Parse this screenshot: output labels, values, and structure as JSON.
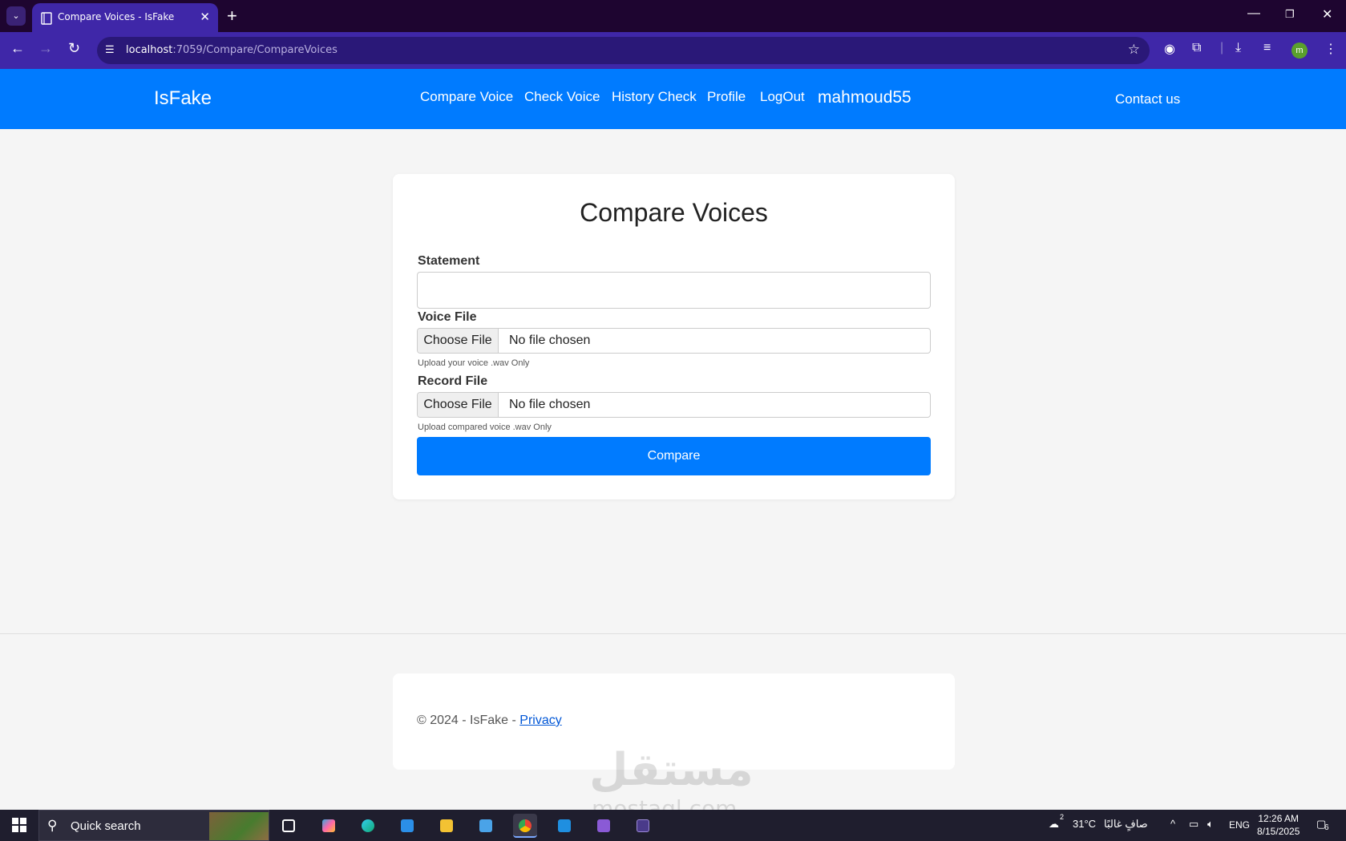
{
  "browser": {
    "tab_title": "Compare Voices - IsFake",
    "url_host": "localhost",
    "url_path": ":7059/Compare/CompareVoices",
    "profile_initial": "m"
  },
  "site": {
    "brand": "IsFake",
    "nav": [
      "Compare Voice",
      "Check Voice",
      "History Check",
      "Profile",
      "LogOut"
    ],
    "username": "mahmoud55",
    "contact": "Contact us"
  },
  "form": {
    "title": "Compare Voices",
    "statement_label": "Statement",
    "statement_value": "",
    "voice_label": "Voice File",
    "voice_button": "Choose File",
    "voice_status": "No file chosen",
    "voice_help": "Upload your voice .wav Only",
    "record_label": "Record File",
    "record_button": "Choose File",
    "record_status": "No file chosen",
    "record_help": "Upload compared voice .wav Only",
    "submit": "Compare"
  },
  "footer": {
    "copyright": "© 2024 - IsFake - ",
    "privacy": "Privacy"
  },
  "watermark": {
    "arabic": "مستقل",
    "latin": "mostaql.com"
  },
  "taskbar": {
    "search": "Quick search",
    "weather_badge": "2",
    "temperature": "31°C",
    "weather_text": "صافٍ غالبًا",
    "language": "ENG",
    "time": "12:26 AM",
    "date": "8/15/2025",
    "notifications": "6"
  },
  "colors": {
    "brand_blue": "#007bff",
    "chrome_purple": "#3f27a8",
    "tabbar": "#1e0530"
  }
}
